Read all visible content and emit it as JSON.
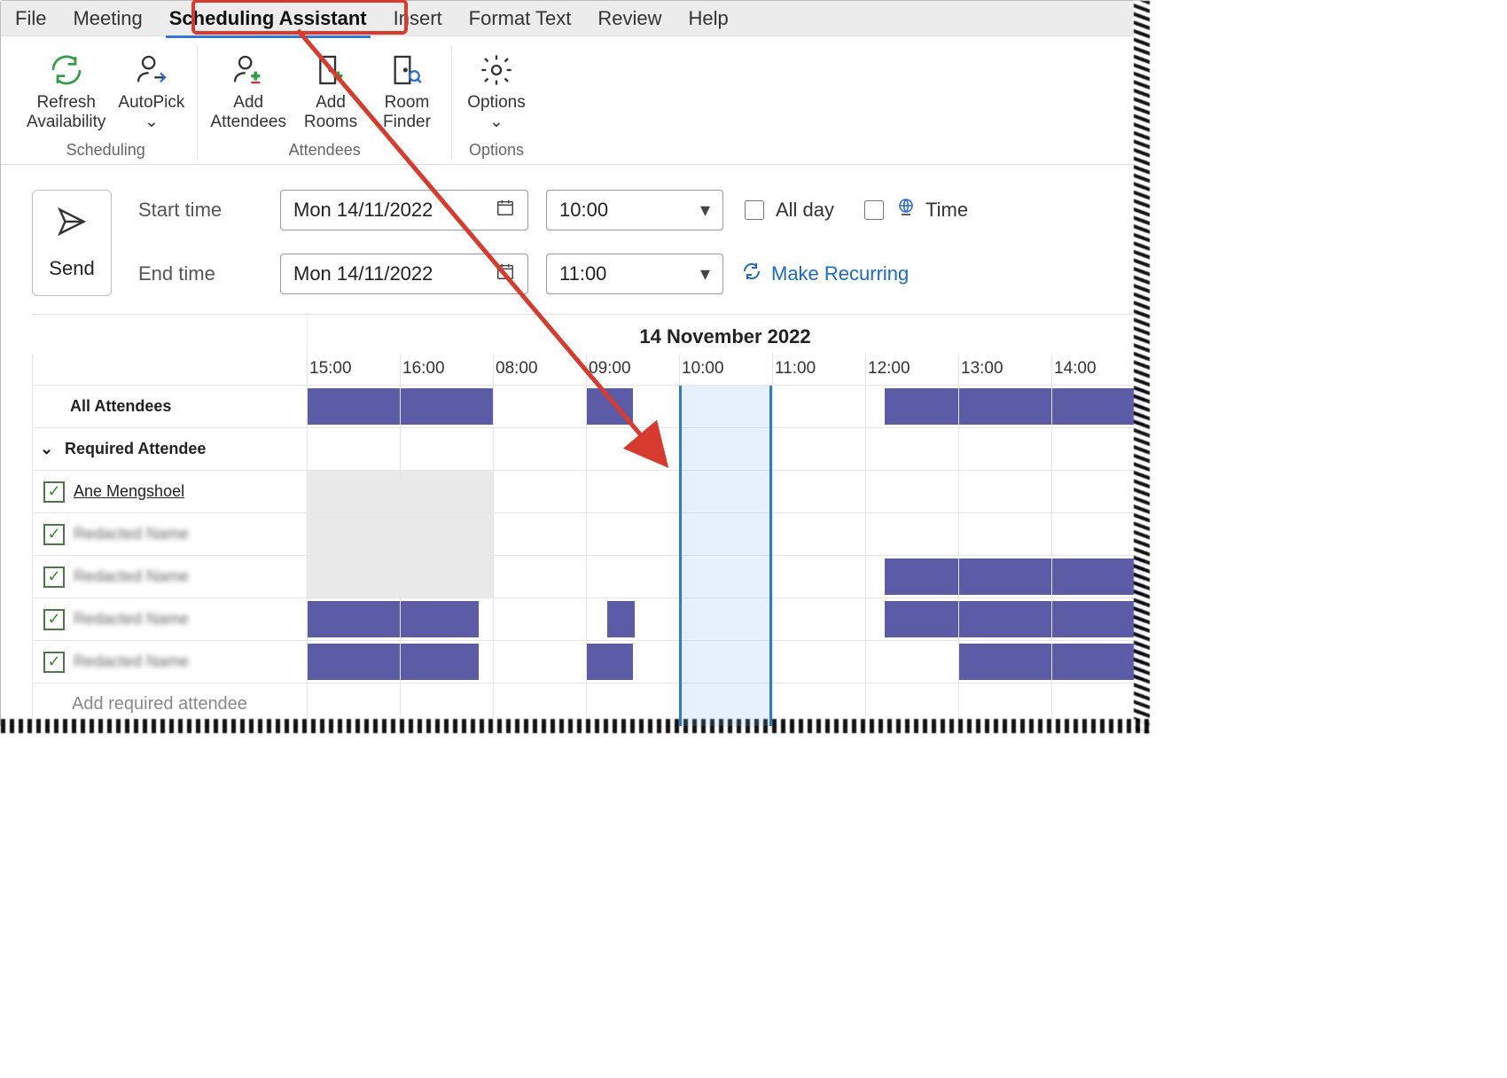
{
  "tabs": {
    "file": "File",
    "meeting": "Meeting",
    "scheduling": "Scheduling Assistant",
    "insert": "Insert",
    "format": "Format Text",
    "review": "Review",
    "help": "Help"
  },
  "ribbon": {
    "groups": {
      "scheduling": {
        "label": "Scheduling",
        "refresh": "Refresh\nAvailability",
        "autopick": "AutoPick"
      },
      "attendees": {
        "label": "Attendees",
        "add_attendees": "Add\nAttendees",
        "add_rooms": "Add\nRooms",
        "room_finder": "Room\nFinder"
      },
      "options": {
        "label": "Options",
        "options": "Options"
      }
    }
  },
  "form": {
    "send": "Send",
    "start_label": "Start time",
    "end_label": "End time",
    "start_date": "Mon 14/11/2022",
    "end_date": "Mon 14/11/2022",
    "start_time": "10:00",
    "end_time": "11:00",
    "all_day": "All day",
    "timezones": "Time",
    "recurring": "Make Recurring"
  },
  "schedule": {
    "date_header": "14 November 2022",
    "time_cols": [
      "15:00",
      "16:00",
      "08:00",
      "09:00",
      "10:00",
      "11:00",
      "12:00",
      "13:00",
      "14:00"
    ],
    "rows": {
      "all": "All Attendees",
      "required": "Required Attendee",
      "add_placeholder": "Add required attendee"
    },
    "attendees": [
      {
        "name": "Ane Mengshoel",
        "clear": true
      },
      {
        "name": "Redacted Name",
        "clear": false
      },
      {
        "name": "Redacted Name",
        "clear": false
      },
      {
        "name": "Redacted Name",
        "clear": false
      },
      {
        "name": "Redacted Name",
        "clear": false
      }
    ]
  }
}
